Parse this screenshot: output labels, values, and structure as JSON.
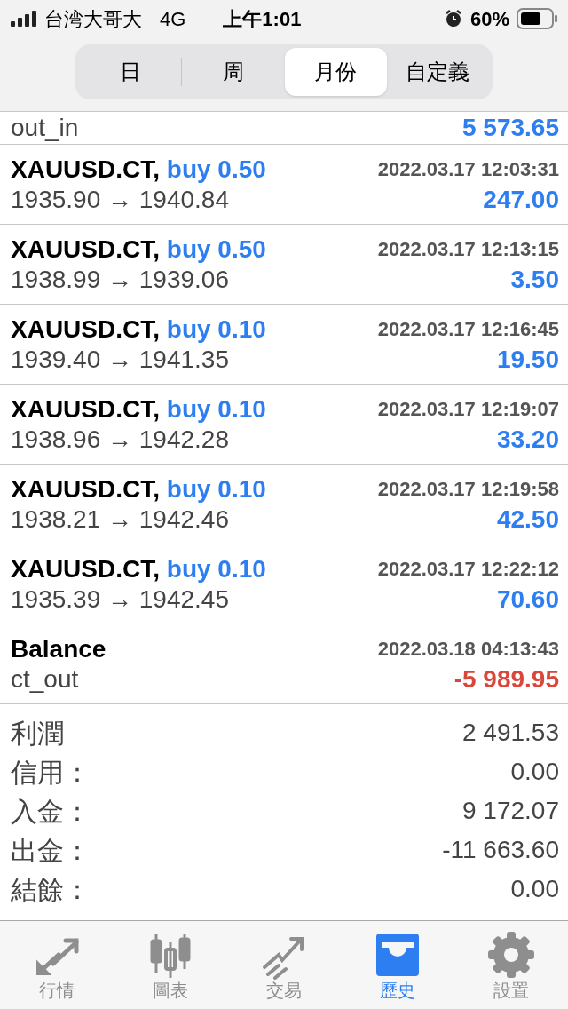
{
  "status_bar": {
    "carrier": "台湾大哥大",
    "network": "4G",
    "time": "上午1:01",
    "battery": "60%",
    "alarm": true
  },
  "period_tabs": [
    {
      "label": "日",
      "selected": false
    },
    {
      "label": "周",
      "selected": false
    },
    {
      "label": "月份",
      "selected": true
    },
    {
      "label": "自定義",
      "selected": false
    }
  ],
  "partial_row": {
    "comment": "out_in",
    "profit": "5 573.65",
    "loss": false
  },
  "deals": [
    {
      "kind": "trade",
      "symbol": "XAUUSD.CT,",
      "side": "buy 0.50",
      "time": "2022.03.17 12:03:31",
      "prices": "1935.90 → 1940.84",
      "profit": "247.00",
      "loss": false
    },
    {
      "kind": "trade",
      "symbol": "XAUUSD.CT,",
      "side": "buy 0.50",
      "time": "2022.03.17 12:13:15",
      "prices": "1938.99 → 1939.06",
      "profit": "3.50",
      "loss": false
    },
    {
      "kind": "trade",
      "symbol": "XAUUSD.CT,",
      "side": "buy 0.10",
      "time": "2022.03.17 12:16:45",
      "prices": "1939.40 → 1941.35",
      "profit": "19.50",
      "loss": false
    },
    {
      "kind": "trade",
      "symbol": "XAUUSD.CT,",
      "side": "buy 0.10",
      "time": "2022.03.17 12:19:07",
      "prices": "1938.96 → 1942.28",
      "profit": "33.20",
      "loss": false
    },
    {
      "kind": "trade",
      "symbol": "XAUUSD.CT,",
      "side": "buy 0.10",
      "time": "2022.03.17 12:19:58",
      "prices": "1938.21 → 1942.46",
      "profit": "42.50",
      "loss": false
    },
    {
      "kind": "trade",
      "symbol": "XAUUSD.CT,",
      "side": "buy 0.10",
      "time": "2022.03.17 12:22:12",
      "prices": "1935.39 → 1942.45",
      "profit": "70.60",
      "loss": false
    },
    {
      "kind": "balance",
      "symbol": "Balance",
      "time": "2022.03.18 04:13:43",
      "prices": "ct_out",
      "profit": "-5 989.95",
      "loss": true
    }
  ],
  "summary": [
    {
      "label": "利潤",
      "value": "2 491.53"
    },
    {
      "label": "信用：",
      "value": "0.00"
    },
    {
      "label": "入金：",
      "value": "9 172.07"
    },
    {
      "label": "出金：",
      "value": "-11 663.60"
    },
    {
      "label": "結餘：",
      "value": "0.00"
    }
  ],
  "tab_bar": [
    {
      "kind": "quotes",
      "label": "行情",
      "selected": false
    },
    {
      "kind": "chart",
      "label": "圖表",
      "selected": false
    },
    {
      "kind": "trade",
      "label": "交易",
      "selected": false
    },
    {
      "kind": "history",
      "label": "歷史",
      "selected": true
    },
    {
      "kind": "settings",
      "label": "設置",
      "selected": false
    }
  ]
}
